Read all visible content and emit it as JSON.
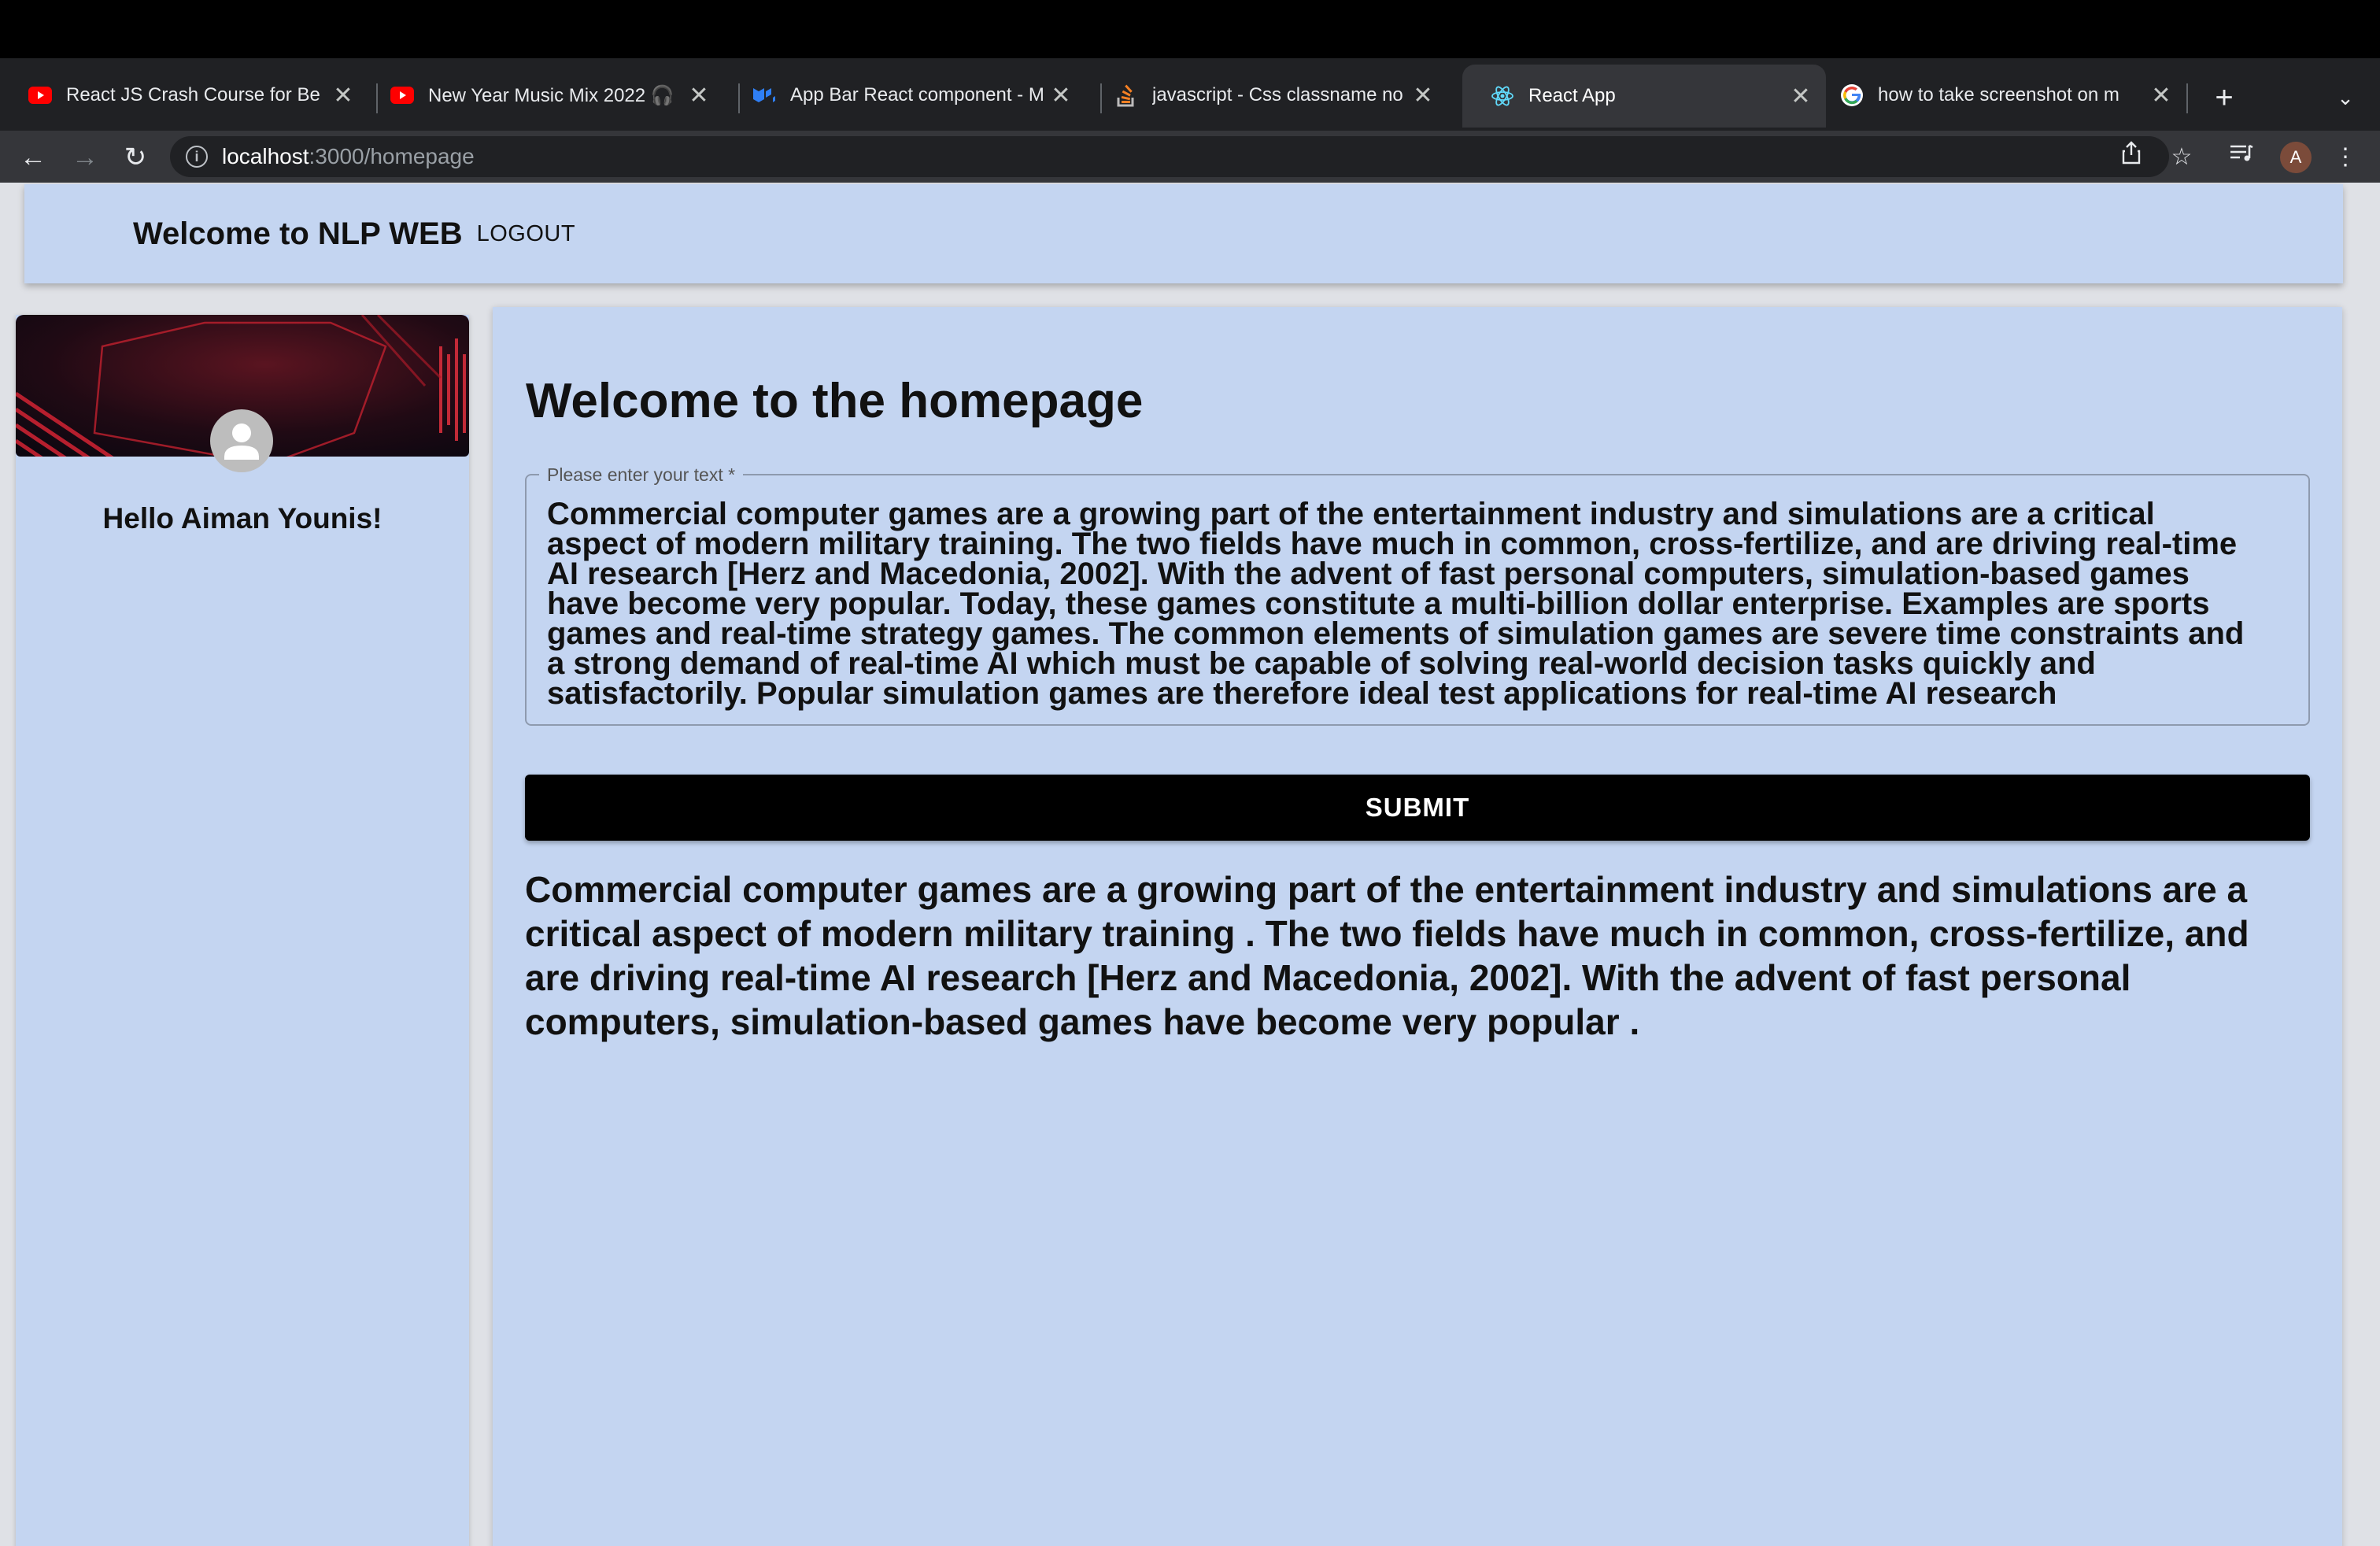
{
  "browser": {
    "tabs": [
      {
        "title": "React JS Crash Course for Be",
        "favicon": "youtube-icon"
      },
      {
        "title": "New Year Music Mix 2022 🎧",
        "favicon": "youtube-icon"
      },
      {
        "title": "App Bar React component - M",
        "favicon": "mui-icon"
      },
      {
        "title": "javascript - Css classname no",
        "favicon": "stackoverflow-icon"
      },
      {
        "title": "React App",
        "favicon": "react-icon",
        "active": true
      },
      {
        "title": "how to take screenshot on m",
        "favicon": "google-icon"
      }
    ],
    "url_host": "localhost",
    "url_path": ":3000/homepage",
    "profile_initial": "A"
  },
  "appbar": {
    "title": "Welcome to NLP WEB",
    "logout_label": "LOGOUT"
  },
  "sidebar": {
    "greeting": "Hello Aiman Younis!"
  },
  "main": {
    "heading": "Welcome to the homepage",
    "input_label": "Please enter your text *",
    "input_value": "Commercial computer games are a growing part of the entertainment industry and simulations are a critical\naspect of modern military training. The two fields have much in common, cross-fertilize, and are driving real-time\nAI research [Herz and Macedonia, 2002]. With the advent of fast personal computers, simulation-based games\nhave become very popular. Today, these games constitute a multi-billion dollar enterprise. Examples are sports\ngames and real-time strategy games. The common elements of simulation games are severe time constraints and\na strong demand of real-time AI which must be capable of solving real-world decision tasks quickly and\nsatisfactorily. Popular simulation games are therefore ideal test applications for real-time AI research",
    "submit_label": "SUBMIT",
    "result_text": "Commercial computer games are a growing part of the entertainment industry and simulations are a\ncritical aspect of modern military training . The two fields have much in common, cross-fertilize, and\nare driving real-time AI research [Herz and Macedonia, 2002]. With the advent of fast personal\ncomputers, simulation-based games have become very popular ."
  },
  "colors": {
    "page_accent": "#c4d5f1",
    "submit_bg": "#000000"
  }
}
